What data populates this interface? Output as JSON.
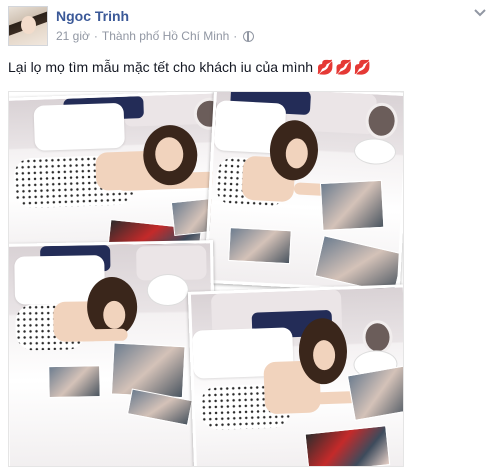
{
  "post": {
    "author": "Ngoc Trinh",
    "time": "21 giờ",
    "separator1": "·",
    "location": "Thành phố Hồ Chí Minh",
    "separator2": "·",
    "text": "Lại lọ mọ tìm mẫu mặc tết cho khách iu của mình",
    "emoji": "💋💋💋"
  },
  "icons": {
    "privacy": "globe-icon",
    "options": "chevron-down-icon"
  },
  "photos": [
    {
      "name": "photo-1"
    },
    {
      "name": "photo-2"
    },
    {
      "name": "photo-3"
    },
    {
      "name": "photo-4"
    }
  ]
}
